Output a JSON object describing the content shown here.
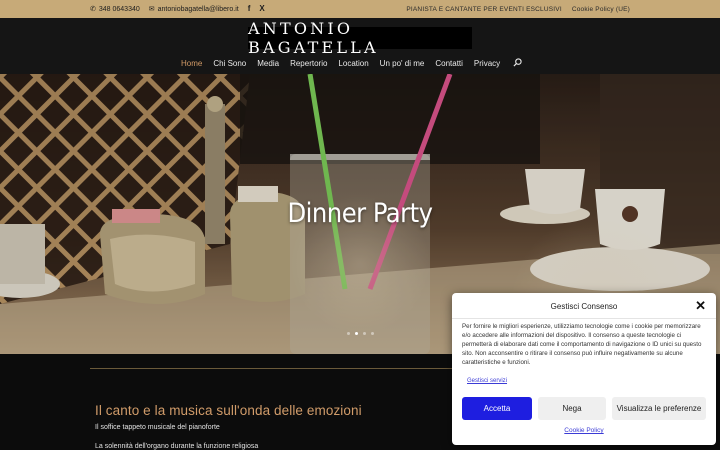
{
  "topbar": {
    "phone": "348 0643340",
    "email": "antoniobagatella@libero.it",
    "social_facebook": "f",
    "social_x": "X",
    "tagline": "PIANISTA E CANTANTE PER EVENTI ESCLUSIVI",
    "cookie_policy_link": "Cookie Policy (UE)",
    "background": "#c7aa78"
  },
  "header": {
    "logo": "ANTONIO BAGATELLA",
    "nav": [
      {
        "label": "Home",
        "active": true
      },
      {
        "label": "Chi Sono"
      },
      {
        "label": "Media"
      },
      {
        "label": "Repertorio"
      },
      {
        "label": "Location"
      },
      {
        "label": "Un po' di me"
      },
      {
        "label": "Contatti"
      },
      {
        "label": "Privacy"
      }
    ],
    "accent": "#d29a66"
  },
  "hero": {
    "title": "Dinner Party",
    "slides_total": 4,
    "slide_active": 2
  },
  "content": {
    "heading": "Il canto e la musica sull'onda delle emozioni",
    "line1": "Il soffice tappeto musicale del pianoforte",
    "line2": "La solennità dell'organo durante la funzione religiosa"
  },
  "consent": {
    "title": "Gestisci Consenso",
    "body": "Per fornire le migliori esperienze, utilizziamo tecnologie come i cookie per memorizzare e/o accedere alle informazioni del dispositivo. Il consenso a queste tecnologie ci permetterà di elaborare dati come il comportamento di navigazione o ID unici su questo sito. Non acconsentire o ritirare il consenso può influire negativamente su alcune caratteristiche e funzioni.",
    "manage_services": "Gestisci servizi",
    "accept": "Accetta",
    "deny": "Nega",
    "preferences": "Visualizza le preferenze",
    "cookie_policy": "Cookie Policy",
    "accept_color": "#1e1ee0"
  }
}
